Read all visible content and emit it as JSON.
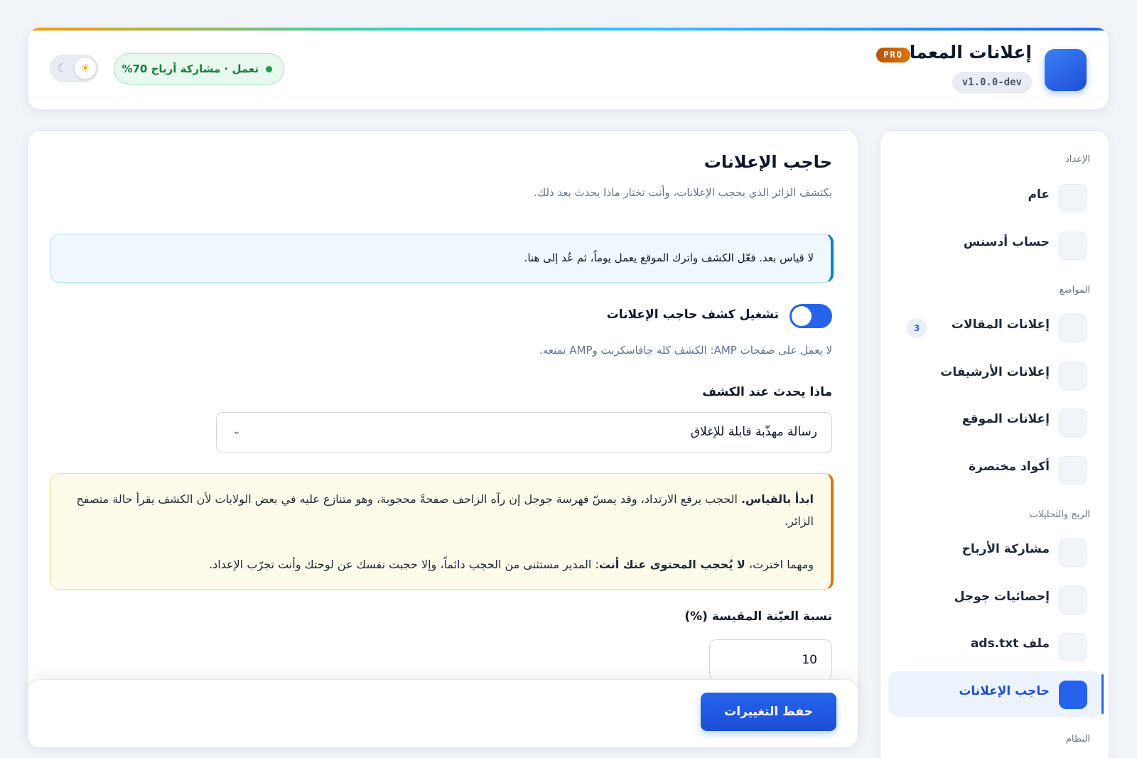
{
  "header": {
    "app_title": "إعلانات المعمار",
    "pro_badge": "PRO",
    "version": "v1.0.0-dev",
    "status": "تعمل · مشاركة أرباح 70%",
    "theme_icons": {
      "light": "sun-icon",
      "dark": "moon-icon"
    }
  },
  "sidebar": {
    "sections": [
      {
        "title": "الإعداد",
        "items": [
          {
            "label": "عام"
          },
          {
            "label": "حساب أدسنس"
          }
        ]
      },
      {
        "title": "المواضع",
        "items": [
          {
            "label": "إعلانات المقالات",
            "count": "3"
          },
          {
            "label": "إعلانات الأرشيفات"
          },
          {
            "label": "إعلانات الموقع"
          },
          {
            "label": "أكواد مختصرة"
          }
        ]
      },
      {
        "title": "الربح والتحليلات",
        "items": [
          {
            "label": "مشاركة الأرباح"
          },
          {
            "label": "إحصائيات جوجل"
          },
          {
            "label": "ملف ads.txt"
          },
          {
            "label": "حاجب الإعلانات",
            "active": true
          }
        ]
      },
      {
        "title": "النظام",
        "items": []
      }
    ]
  },
  "main": {
    "title": "حاجب الإعلانات",
    "description": "يكتشف الزائر الذي يحجب الإعلانات، وأنت تختار ماذا يحدث بعد ذلك.",
    "info_notice": "لا قياس بعد. فعّل الكشف واترك الموقع يعمل يوماً، ثم عُد إلى هنا.",
    "detection_toggle": {
      "label": "تشغيل كشف حاجب الإعلانات",
      "enabled": false
    },
    "detection_help": "لا يعمل على صفحات AMP: الكشف كله جافاسكربت وAMP تمنعه.",
    "action_field": {
      "label": "ماذا يحدث عند الكشف",
      "value": "رسالة مهذّبة قابلة للإغلاق"
    },
    "warning": {
      "p1_strong": "ابدأ بالقياس.",
      "p1_text": " الحجب يرفع الارتداد، وقد يمسّ فهرسة جوجل إن رآه الزاحف صفحةً محجوبة، وهو متنازع عليه في بعض الولايات لأن الكشف يقرأ حالة متصفح الزائر.",
      "p2_text_a": "ومهما اخترت، ",
      "p2_strong": "لا يُحجب المحتوى عنك أنت",
      "p2_text_b": ": المدير مستثنى من الحجب دائماً، وإلا حجبت نفسك عن لوحتك وأنت تجرّب الإعداد."
    },
    "sample_field": {
      "label": "نسبة العيّنة المقيسة (%)",
      "value": "10"
    }
  },
  "footer": {
    "save_label": "حفظ التغييرات"
  },
  "colors": {
    "accent": "#2563eb",
    "success": "#16a34a",
    "warning": "#d97706",
    "info": "#0284c7"
  }
}
